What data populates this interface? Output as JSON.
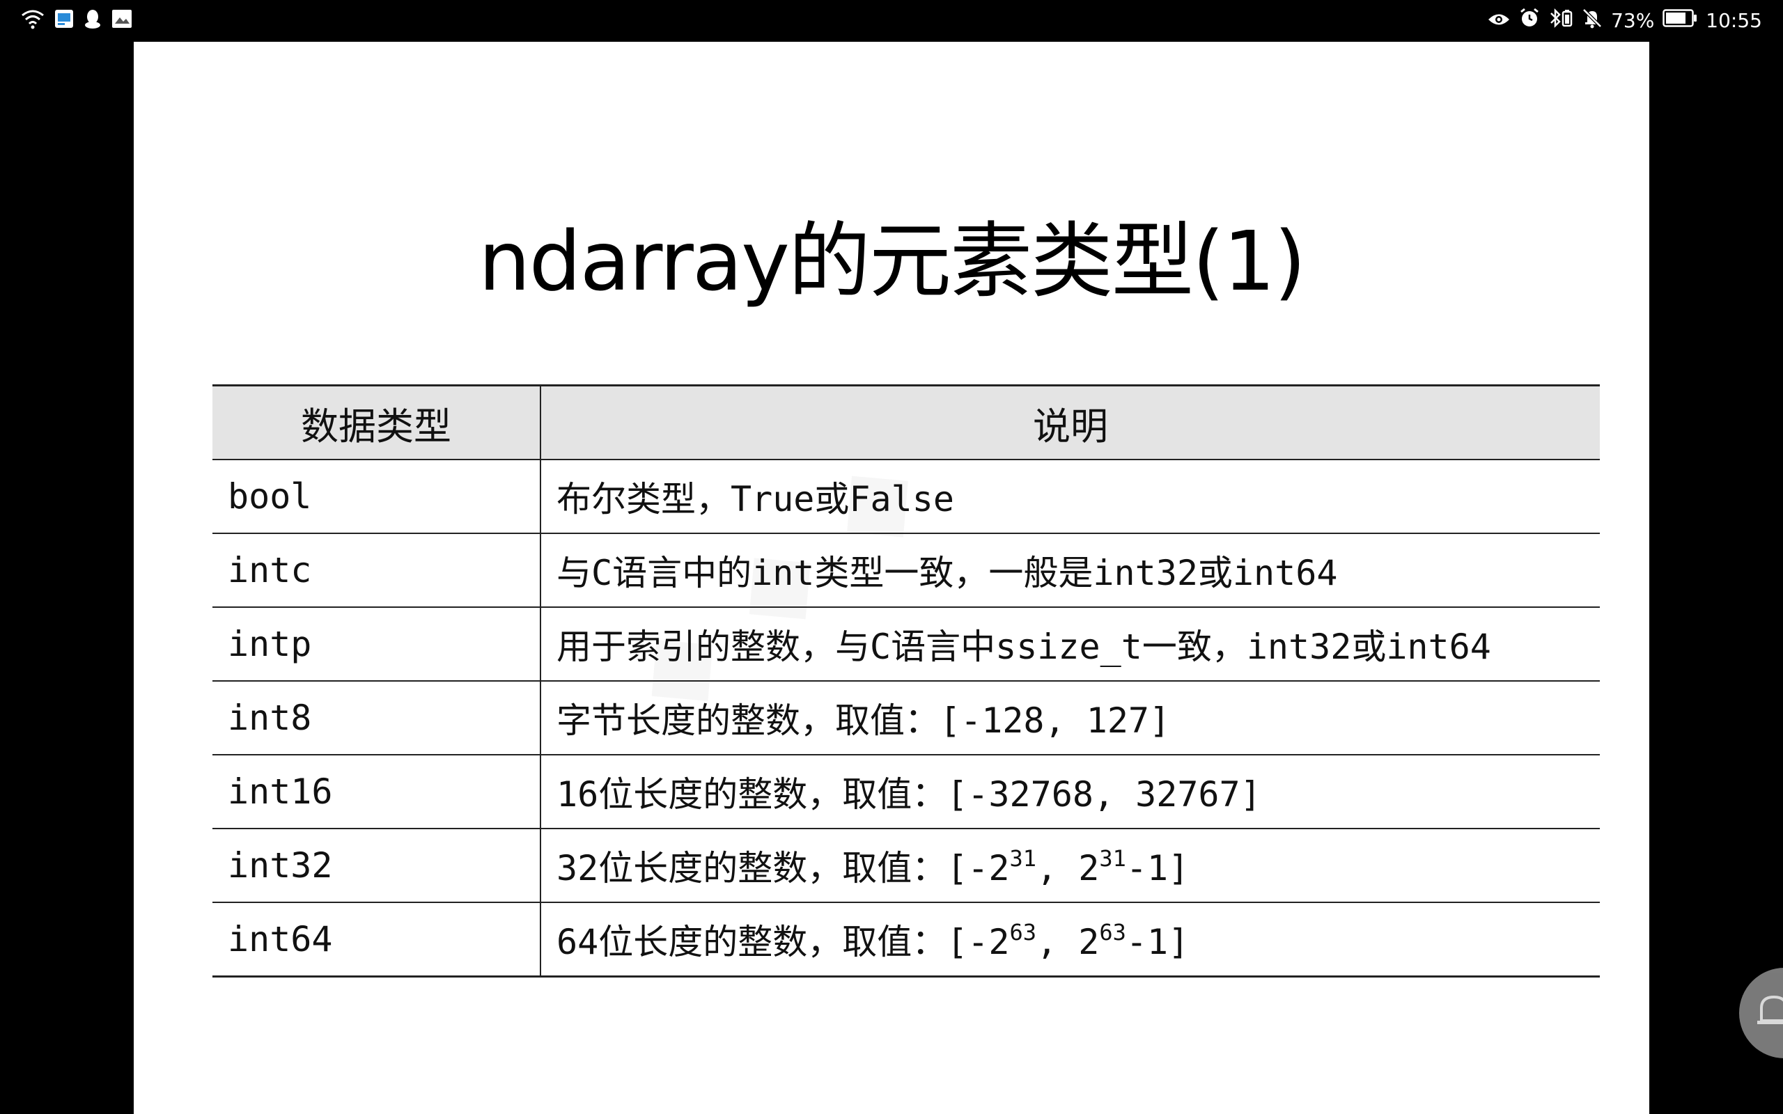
{
  "status_bar": {
    "battery": "73%",
    "time": "10:55",
    "icons_left": [
      "wifi-icon",
      "app-notification-icon",
      "qq-icon",
      "gallery-icon"
    ],
    "icons_right": [
      "eye-icon",
      "alarm-icon",
      "bluetooth-icon",
      "mute-icon",
      "battery-icon"
    ]
  },
  "slide": {
    "title": "ndarray的元素类型(1)",
    "table": {
      "headers": [
        "数据类型",
        "说明"
      ],
      "rows": [
        {
          "type": "bool",
          "desc": "布尔类型，True或False"
        },
        {
          "type": "intc",
          "desc": "与C语言中的int类型一致，一般是int32或int64"
        },
        {
          "type": "intp",
          "desc": "用于索引的整数，与C语言中ssize_t一致，int32或int64"
        },
        {
          "type": "int8",
          "desc": "字节长度的整数，取值：[-128, 127]"
        },
        {
          "type": "int16",
          "desc": "16位长度的整数，取值：[-32768, 32767]"
        },
        {
          "type": "int32",
          "desc_pre": "32位长度的整数，取值：[-2",
          "desc_exp1": "31",
          "desc_mid": ", 2",
          "desc_exp2": "31",
          "desc_post": "-1]"
        },
        {
          "type": "int64",
          "desc_pre": "64位长度的整数，取值：[-2",
          "desc_exp1": "63",
          "desc_mid": ", 2",
          "desc_exp2": "63",
          "desc_post": "-1]"
        }
      ]
    }
  },
  "colors": {
    "header_bg": "#e4e4e4",
    "slide_bg": "#ffffff",
    "frame_bg": "#000000"
  }
}
